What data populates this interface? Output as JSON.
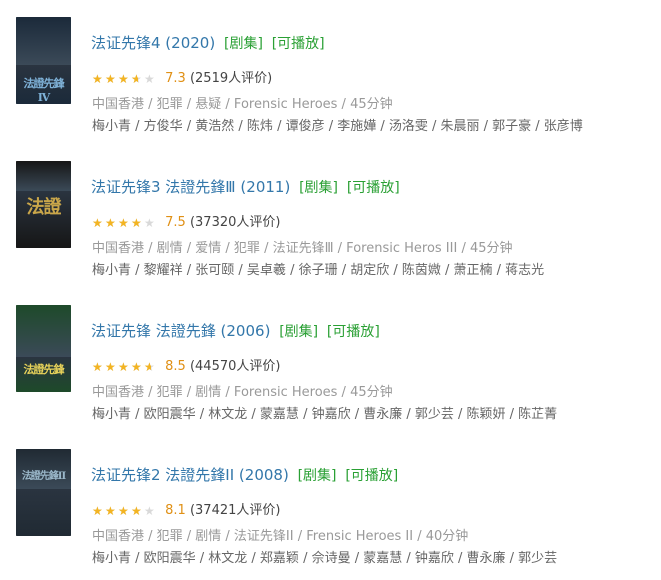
{
  "items": [
    {
      "title": "法证先锋4 (2020)",
      "tags": [
        "[剧集]",
        "[可播放]"
      ],
      "rating": {
        "stars": 3.5,
        "max": 5,
        "score": "7.3",
        "count": "(2519人评价)"
      },
      "meta": "中国香港 / 犯罪 / 悬疑 / Forensic Heroes / 45分钟",
      "cast": "梅小青 / 方俊华 / 黄浩然 / 陈炜 / 谭俊彦 / 李施嬅 / 汤洛雯 / 朱晨丽 / 郭子豪 / 张彦博",
      "poster": {
        "bg": "#1b2a3a",
        "accent": "#7fb2d8",
        "logo": "法證先鋒Ⅳ"
      }
    },
    {
      "title": "法证先锋3 法證先鋒Ⅲ (2011)",
      "tags": [
        "[剧集]",
        "[可播放]"
      ],
      "rating": {
        "stars": 4,
        "max": 5,
        "score": "7.5",
        "count": "(37320人评价)"
      },
      "meta": "中国香港 / 剧情 / 爱情 / 犯罪 / 法证先锋Ⅲ / Forensic Heros III / 45分钟",
      "cast": "梅小青 / 黎耀祥 / 张可颐 / 吴卓羲 / 徐子珊 / 胡定欣 / 陈茵媺 / 萧正楠 / 蒋志光",
      "poster": {
        "bg": "#161616",
        "accent": "#c9a64a",
        "logo": "法證"
      }
    },
    {
      "title": "法证先锋 法證先鋒 (2006)",
      "tags": [
        "[剧集]",
        "[可播放]"
      ],
      "rating": {
        "stars": 4.5,
        "max": 5,
        "score": "8.5",
        "count": "(44570人评价)"
      },
      "meta": "中国香港 / 犯罪 / 剧情 / Forensic Heroes / 45分钟",
      "cast": "梅小青 / 欧阳震华 / 林文龙 / 蒙嘉慧 / 钟嘉欣 / 曹永廉 / 郭少芸 / 陈颖妍 / 陈芷菁",
      "poster": {
        "bg": "#1e4a2a",
        "accent": "#e8d25a",
        "logo": "法證先鋒"
      }
    },
    {
      "title": "法证先锋2 法證先鋒II (2008)",
      "tags": [
        "[剧集]",
        "[可播放]"
      ],
      "rating": {
        "stars": 4,
        "max": 5,
        "score": "8.1",
        "count": "(37421人评价)"
      },
      "meta": "中国香港 / 犯罪 / 剧情 / 法证先锋II / Frensic Heroes II / 40分钟",
      "cast": "梅小青 / 欧阳震华 / 林文龙 / 郑嘉颖 / 佘诗曼 / 蒙嘉慧 / 钟嘉欣 / 曹永廉 / 郭少芸",
      "poster": {
        "bg": "#202a33",
        "accent": "#9ab7c9",
        "logo": "法證先鋒II"
      }
    }
  ]
}
